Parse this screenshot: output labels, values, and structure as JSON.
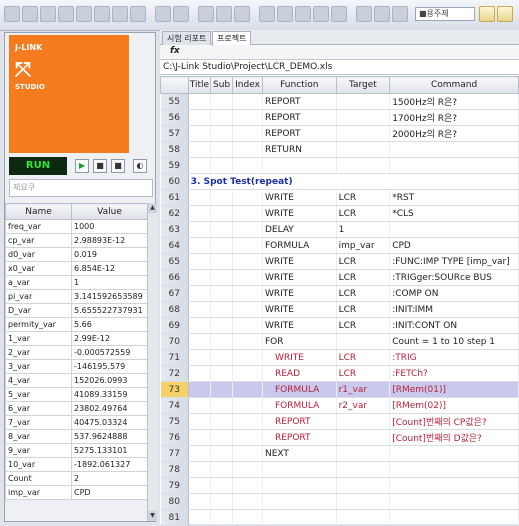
{
  "toolbar": {
    "search_text": "■용주제"
  },
  "left_panel": {
    "logo": {
      "line1": "J-LINK",
      "symbol": "⤧",
      "line2": "STUDIO"
    },
    "run_label": "RUN",
    "search_placeholder": "제요쿠",
    "variables_header": {
      "name": "Name",
      "value": "Value"
    },
    "variables": [
      {
        "name": "freq_var",
        "value": "1000"
      },
      {
        "name": "cp_var",
        "value": "2.98893E-12"
      },
      {
        "name": "d0_var",
        "value": "0.019"
      },
      {
        "name": "x0_var",
        "value": "6.854E-12"
      },
      {
        "name": "a_var",
        "value": "1"
      },
      {
        "name": "pi_var",
        "value": "3.141592653589"
      },
      {
        "name": "D_var",
        "value": "5.655522737931"
      },
      {
        "name": "permity_var",
        "value": "5.66"
      },
      {
        "name": "1_var",
        "value": "2.99E-12"
      },
      {
        "name": "2_var",
        "value": "-0.000572559"
      },
      {
        "name": "3_var",
        "value": "-146195.579"
      },
      {
        "name": "4_var",
        "value": "152026.0993"
      },
      {
        "name": "5_var",
        "value": "41089.33159"
      },
      {
        "name": "6_var",
        "value": "23802.49764"
      },
      {
        "name": "7_var",
        "value": "40475.03324"
      },
      {
        "name": "8_var",
        "value": "537.9624888"
      },
      {
        "name": "9_var",
        "value": "5275.133101"
      },
      {
        "name": "10_var",
        "value": "-1892.061327"
      },
      {
        "name": "Count",
        "value": "2"
      },
      {
        "name": "imp_var",
        "value": "CPD"
      }
    ]
  },
  "right_panel": {
    "tabs": [
      "시험 리포트",
      "프로젝트"
    ],
    "fx_label": "fx",
    "file_path": "C:\\J-Link Studio\\Project\\LCR_DEMO.xls",
    "columns": [
      "",
      "Title",
      "Sub",
      "Index",
      "Function",
      "Target",
      "Command"
    ],
    "rows": [
      {
        "n": "55",
        "title": "",
        "function": "REPORT",
        "target": "",
        "command": "1500Hz의 R은?",
        "style": ""
      },
      {
        "n": "56",
        "title": "",
        "function": "REPORT",
        "target": "",
        "command": "1700Hz의 R은?",
        "style": ""
      },
      {
        "n": "57",
        "title": "",
        "function": "REPORT",
        "target": "",
        "command": "2000Hz의 R은?",
        "style": ""
      },
      {
        "n": "58",
        "title": "",
        "function": "RETURN",
        "target": "",
        "command": "",
        "style": ""
      },
      {
        "n": "59",
        "title": "",
        "function": "",
        "target": "",
        "command": "",
        "style": ""
      },
      {
        "n": "60",
        "title": "3. Spot Test(repeat)",
        "function": "",
        "target": "",
        "command": "",
        "style": "section"
      },
      {
        "n": "61",
        "title": "",
        "function": "WRITE",
        "target": "LCR",
        "command": "*RST",
        "style": ""
      },
      {
        "n": "62",
        "title": "",
        "function": "WRITE",
        "target": "LCR",
        "command": "*CLS",
        "style": ""
      },
      {
        "n": "63",
        "title": "",
        "function": "DELAY",
        "target": "1",
        "command": "",
        "style": ""
      },
      {
        "n": "64",
        "title": "",
        "function": "FORMULA",
        "target": "imp_var",
        "command": "CPD",
        "style": ""
      },
      {
        "n": "65",
        "title": "",
        "function": "WRITE",
        "target": "LCR",
        "command": ":FUNC:IMP TYPE [imp_var]",
        "style": ""
      },
      {
        "n": "66",
        "title": "",
        "function": "WRITE",
        "target": "LCR",
        "command": ":TRIGger:SOURce BUS",
        "style": ""
      },
      {
        "n": "67",
        "title": "",
        "function": "WRITE",
        "target": "LCR",
        "command": ":COMP ON",
        "style": ""
      },
      {
        "n": "68",
        "title": "",
        "function": "WRITE",
        "target": "LCR",
        "command": ":INIT:IMM",
        "style": ""
      },
      {
        "n": "69",
        "title": "",
        "function": "WRITE",
        "target": "LCR",
        "command": ":INIT:CONT ON",
        "style": ""
      },
      {
        "n": "70",
        "title": "",
        "function": "FOR",
        "target": "",
        "command": "Count = 1 to 10 step 1",
        "style": ""
      },
      {
        "n": "71",
        "title": "",
        "function": "WRITE",
        "target": "LCR",
        "command": ":TRIG",
        "style": "indent"
      },
      {
        "n": "72",
        "title": "",
        "function": "READ",
        "target": "LCR",
        "command": ":FETCh?",
        "style": "indent"
      },
      {
        "n": "73",
        "title": "",
        "function": "FORMULA",
        "target": "r1_var",
        "command": "[RMem(01)]",
        "style": "selected"
      },
      {
        "n": "74",
        "title": "",
        "function": "FORMULA",
        "target": "r2_var",
        "command": "[RMem(02)]",
        "style": "indent"
      },
      {
        "n": "75",
        "title": "",
        "function": "REPORT",
        "target": "",
        "command": "[Count]번째의 CP값은?",
        "style": "indent"
      },
      {
        "n": "76",
        "title": "",
        "function": "REPORT",
        "target": "",
        "command": "[Count]번째의 D값은?",
        "style": "indent"
      },
      {
        "n": "77",
        "title": "",
        "function": "NEXT",
        "target": "",
        "command": "",
        "style": ""
      },
      {
        "n": "78",
        "title": "",
        "function": "",
        "target": "",
        "command": "",
        "style": ""
      },
      {
        "n": "79",
        "title": "",
        "function": "",
        "target": "",
        "command": "",
        "style": ""
      },
      {
        "n": "80",
        "title": "",
        "function": "",
        "target": "",
        "command": "",
        "style": ""
      },
      {
        "n": "81",
        "title": "",
        "function": "",
        "target": "",
        "command": "",
        "style": ""
      }
    ]
  }
}
